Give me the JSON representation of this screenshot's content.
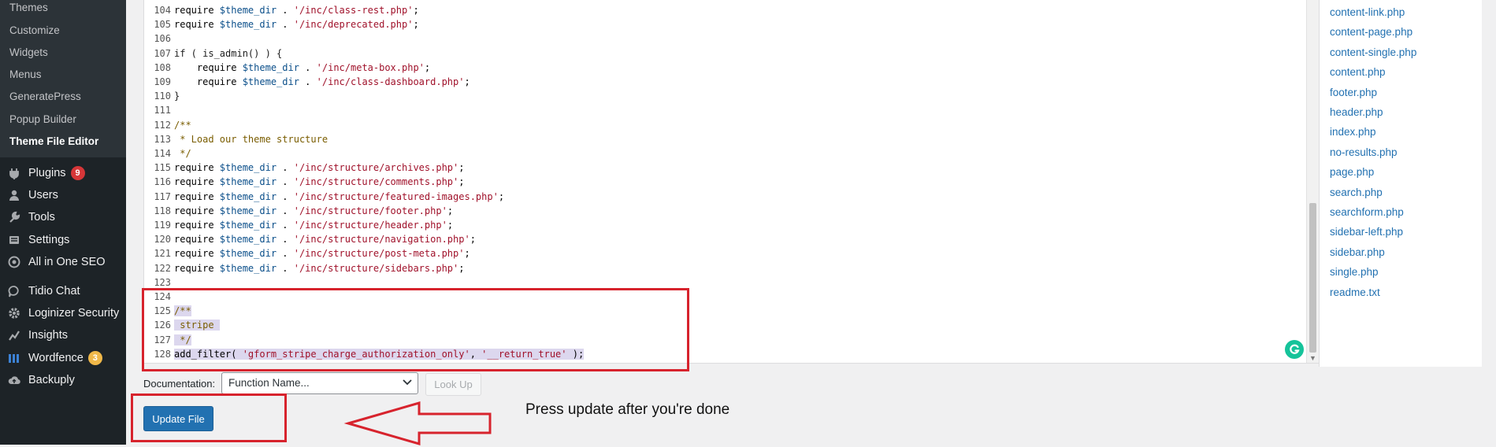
{
  "sidebar": {
    "submenu": [
      {
        "label": "Themes"
      },
      {
        "label": "Customize"
      },
      {
        "label": "Widgets"
      },
      {
        "label": "Menus"
      },
      {
        "label": "GeneratePress"
      },
      {
        "label": "Popup Builder"
      },
      {
        "label": "Theme File Editor",
        "current": true
      }
    ],
    "menu": [
      {
        "label": "Plugins",
        "icon": "plug-icon",
        "badge": "9",
        "badge_color": "#d63638"
      },
      {
        "label": "Users",
        "icon": "users-icon"
      },
      {
        "label": "Tools",
        "icon": "wrench-icon"
      },
      {
        "label": "Settings",
        "icon": "settings-icon"
      },
      {
        "label": "All in One SEO",
        "icon": "aioseo-icon"
      },
      {
        "label": "Tidio Chat",
        "icon": "chat-icon"
      },
      {
        "label": "Loginizer Security",
        "icon": "gear-icon"
      },
      {
        "label": "Insights",
        "icon": "insights-icon"
      },
      {
        "label": "Wordfence",
        "icon": "wordfence-icon",
        "badge": "3",
        "badge_color": "#f0b849"
      },
      {
        "label": "Backuply",
        "icon": "cloud-upload-icon"
      }
    ]
  },
  "editor": {
    "lines": [
      {
        "n": "104",
        "text": "require $theme_dir . '/inc/class-rest.php';",
        "kind": "require"
      },
      {
        "n": "105",
        "text": "require $theme_dir . '/inc/deprecated.php';",
        "kind": "require"
      },
      {
        "n": "106",
        "text": "",
        "kind": "plain"
      },
      {
        "n": "107",
        "text": "if ( is_admin() ) {",
        "kind": "plain"
      },
      {
        "n": "108",
        "text": "    require $theme_dir . '/inc/meta-box.php';",
        "kind": "require"
      },
      {
        "n": "109",
        "text": "    require $theme_dir . '/inc/class-dashboard.php';",
        "kind": "require"
      },
      {
        "n": "110",
        "text": "}",
        "kind": "plain"
      },
      {
        "n": "111",
        "text": "",
        "kind": "plain"
      },
      {
        "n": "112",
        "text": "/**",
        "kind": "comment"
      },
      {
        "n": "113",
        "text": " * Load our theme structure",
        "kind": "comment"
      },
      {
        "n": "114",
        "text": " */",
        "kind": "comment"
      },
      {
        "n": "115",
        "text": "require $theme_dir . '/inc/structure/archives.php';",
        "kind": "require"
      },
      {
        "n": "116",
        "text": "require $theme_dir . '/inc/structure/comments.php';",
        "kind": "require"
      },
      {
        "n": "117",
        "text": "require $theme_dir . '/inc/structure/featured-images.php';",
        "kind": "require"
      },
      {
        "n": "118",
        "text": "require $theme_dir . '/inc/structure/footer.php';",
        "kind": "require"
      },
      {
        "n": "119",
        "text": "require $theme_dir . '/inc/structure/header.php';",
        "kind": "require"
      },
      {
        "n": "120",
        "text": "require $theme_dir . '/inc/structure/navigation.php';",
        "kind": "require"
      },
      {
        "n": "121",
        "text": "require $theme_dir . '/inc/structure/post-meta.php';",
        "kind": "require"
      },
      {
        "n": "122",
        "text": "require $theme_dir . '/inc/structure/sidebars.php';",
        "kind": "require"
      },
      {
        "n": "123",
        "text": "",
        "kind": "plain"
      },
      {
        "n": "124",
        "text": "",
        "kind": "plain"
      },
      {
        "n": "125",
        "text": "/**",
        "kind": "comment",
        "selected": true
      },
      {
        "n": "126",
        "text": " stripe ",
        "kind": "comment",
        "selected": true
      },
      {
        "n": "127",
        "text": " */",
        "kind": "comment",
        "selected": true
      },
      {
        "n": "128",
        "text": "add_filter( 'gform_stripe_charge_authorization_only', '__return_true' );",
        "kind": "filter",
        "selected": true
      }
    ]
  },
  "files": [
    "content-link.php",
    "content-page.php",
    "content-single.php",
    "content.php",
    "footer.php",
    "header.php",
    "index.php",
    "no-results.php",
    "page.php",
    "search.php",
    "searchform.php",
    "sidebar-left.php",
    "sidebar.php",
    "single.php",
    "readme.txt"
  ],
  "controls": {
    "documentation_label": "Documentation:",
    "function_select_value": "Function Name...",
    "lookup_label": "Look Up",
    "update_label": "Update File"
  },
  "annotation": {
    "instruction": "Press update after you're done",
    "highlight_color": "#d7232d"
  },
  "colors": {
    "admin_menu_bg": "#1d2327",
    "submenu_bg": "#2c3338",
    "primary_button": "#2271b1",
    "link": "#2271b1",
    "selection": "#dcd7ee"
  }
}
